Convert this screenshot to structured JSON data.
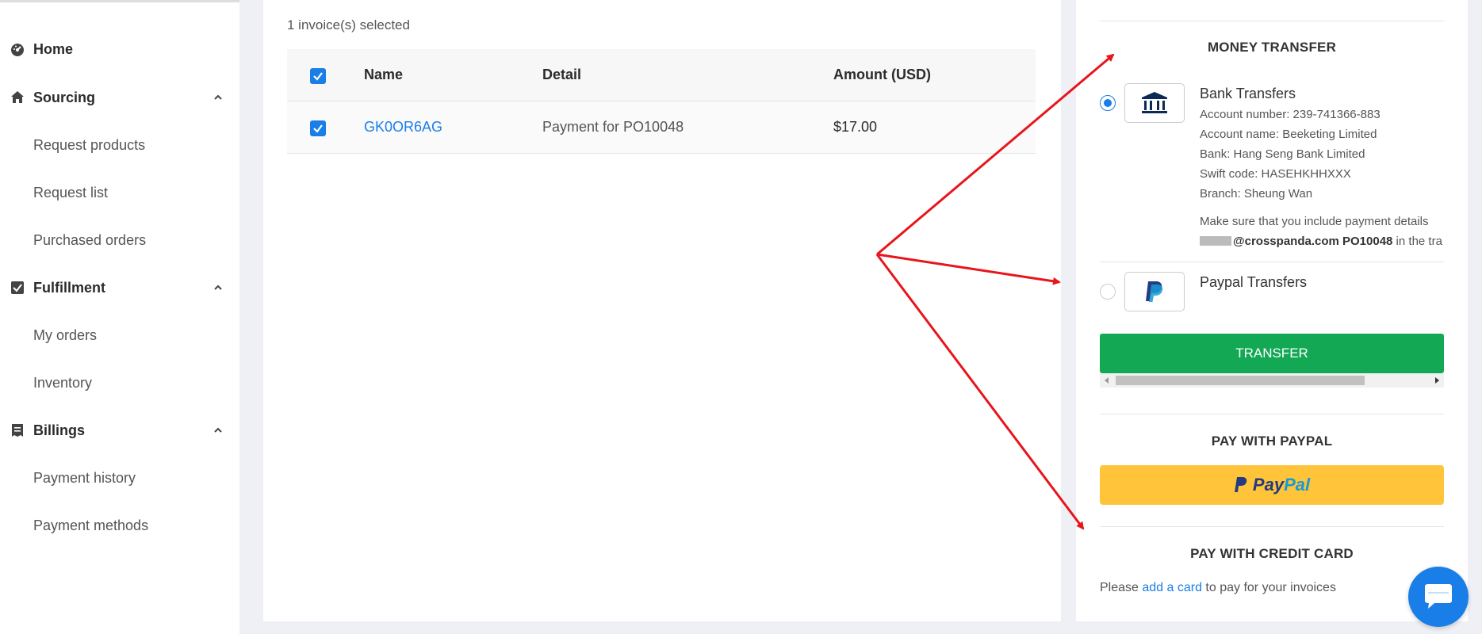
{
  "sidebar": {
    "items": [
      {
        "label": "Home",
        "icon": "dashboard-icon",
        "type": "top"
      },
      {
        "label": "Sourcing",
        "icon": "home-icon",
        "type": "top",
        "expanded": true
      },
      {
        "label": "Request products",
        "type": "sub"
      },
      {
        "label": "Request list",
        "type": "sub"
      },
      {
        "label": "Purchased orders",
        "type": "sub"
      },
      {
        "label": "Fulfillment",
        "icon": "checkbox-icon",
        "type": "top",
        "expanded": true
      },
      {
        "label": "My orders",
        "type": "sub"
      },
      {
        "label": "Inventory",
        "type": "sub"
      },
      {
        "label": "Billings",
        "icon": "receipt-icon",
        "type": "top",
        "expanded": true
      },
      {
        "label": "Payment history",
        "type": "sub"
      },
      {
        "label": "Payment methods",
        "type": "sub"
      }
    ]
  },
  "invoices": {
    "selected_text": "1 invoice(s) selected",
    "columns": [
      "Name",
      "Detail",
      "Amount (USD)"
    ],
    "rows": [
      {
        "name": "GK0OR6AG",
        "detail": "Payment for PO10048",
        "amount": "$17.00",
        "checked": true
      }
    ]
  },
  "payment": {
    "money_transfer_title": "MONEY TRANSFER",
    "bank": {
      "title": "Bank Transfers",
      "selected": true,
      "account_number": "Account number: 239-741366-883",
      "account_name": "Account name: Beeketing Limited",
      "bank": "Bank: Hang Seng Bank Limited",
      "swift": "Swift code: HASEHKHHXXX",
      "branch": "Branch: Sheung Wan",
      "note_line1": "Make sure that you include payment details",
      "note_email": "@crosspanda.com PO10048",
      "note_tail": " in the tra"
    },
    "paypal_transfer": {
      "title": "Paypal Transfers",
      "selected": false
    },
    "transfer_button": "TRANSFER",
    "pay_with_paypal_title": "PAY WITH PAYPAL",
    "paypal_button_pay": "Pay",
    "paypal_button_pal": "Pal",
    "pay_with_card_title": "PAY WITH CREDIT CARD",
    "card_text_before": "Please ",
    "card_link": "add a card",
    "card_text_after": " to pay for your invoices"
  },
  "colors": {
    "accent": "#1a7ee8",
    "transfer_green": "#12a854",
    "paypal_yellow": "#ffc439",
    "arrow_red": "#e8151b"
  }
}
